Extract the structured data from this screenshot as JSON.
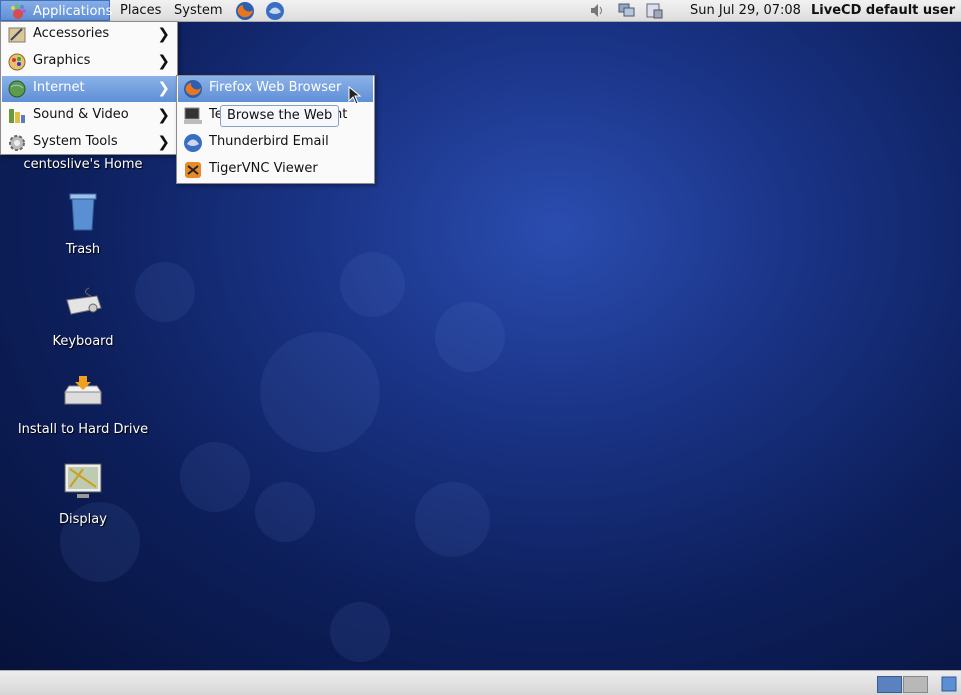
{
  "top_panel": {
    "applications_label": "Applications",
    "places_label": "Places",
    "system_label": "System",
    "clock": "Sun Jul 29, 07:08",
    "user": "LiveCD default user"
  },
  "applications_menu": {
    "items": [
      {
        "label": "Accessories",
        "icon": "accessories-icon"
      },
      {
        "label": "Graphics",
        "icon": "graphics-icon"
      },
      {
        "label": "Internet",
        "icon": "internet-icon"
      },
      {
        "label": "Sound & Video",
        "icon": "sound-video-icon"
      },
      {
        "label": "System Tools",
        "icon": "system-tools-icon"
      }
    ]
  },
  "internet_submenu": {
    "items": [
      {
        "label": "Firefox Web Browser",
        "icon": "firefox-icon"
      },
      {
        "label": "Te",
        "label_end": "nt",
        "icon": "terminal-icon"
      },
      {
        "label": "Thunderbird Email",
        "icon": "thunderbird-icon"
      },
      {
        "label": "TigerVNC Viewer",
        "icon": "tigervnc-icon"
      }
    ]
  },
  "tooltip": "Browse the Web",
  "desktop": {
    "home_label": "centoslive's Home",
    "icons": [
      {
        "label": "Trash"
      },
      {
        "label": "Keyboard"
      },
      {
        "label": "Install to Hard Drive"
      },
      {
        "label": "Display"
      }
    ]
  },
  "colors": {
    "menu_highlight": "#6f9ddf",
    "desktop_bg": "#1a3487"
  }
}
